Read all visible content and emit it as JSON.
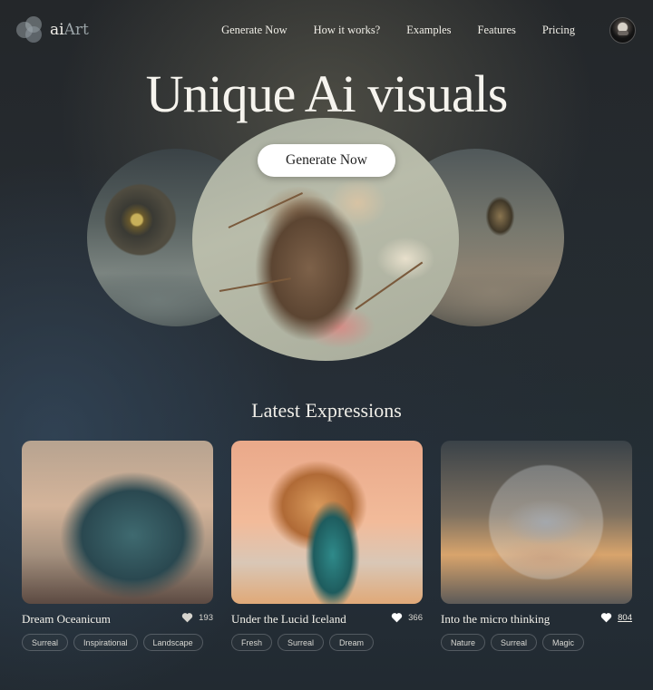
{
  "nav": {
    "logo_prefix": "ai",
    "logo_suffix": "Art",
    "links": [
      "Generate Now",
      "How it works?",
      "Examples",
      "Features",
      "Pricing"
    ]
  },
  "hero": {
    "title": "Unique Ai visuals",
    "cta_label": "Generate Now"
  },
  "section": {
    "title": "Latest Expressions"
  },
  "cards": [
    {
      "title": "Dream Oceanicum",
      "likes": "193",
      "tags": [
        "Surreal",
        "Inspirational",
        "Landscape"
      ]
    },
    {
      "title": "Under the Lucid Iceland",
      "likes": "366",
      "tags": [
        "Fresh",
        "Surreal",
        "Dream"
      ]
    },
    {
      "title": "Into the micro thinking",
      "likes": "804",
      "tags": [
        "Nature",
        "Surreal",
        "Magic"
      ]
    }
  ],
  "icons": {
    "logo": "logo-overlapping-circles-icon",
    "heart": "heart-icon"
  },
  "colors": {
    "cta_background": "#ffffff",
    "text": "#f3f1ea"
  }
}
